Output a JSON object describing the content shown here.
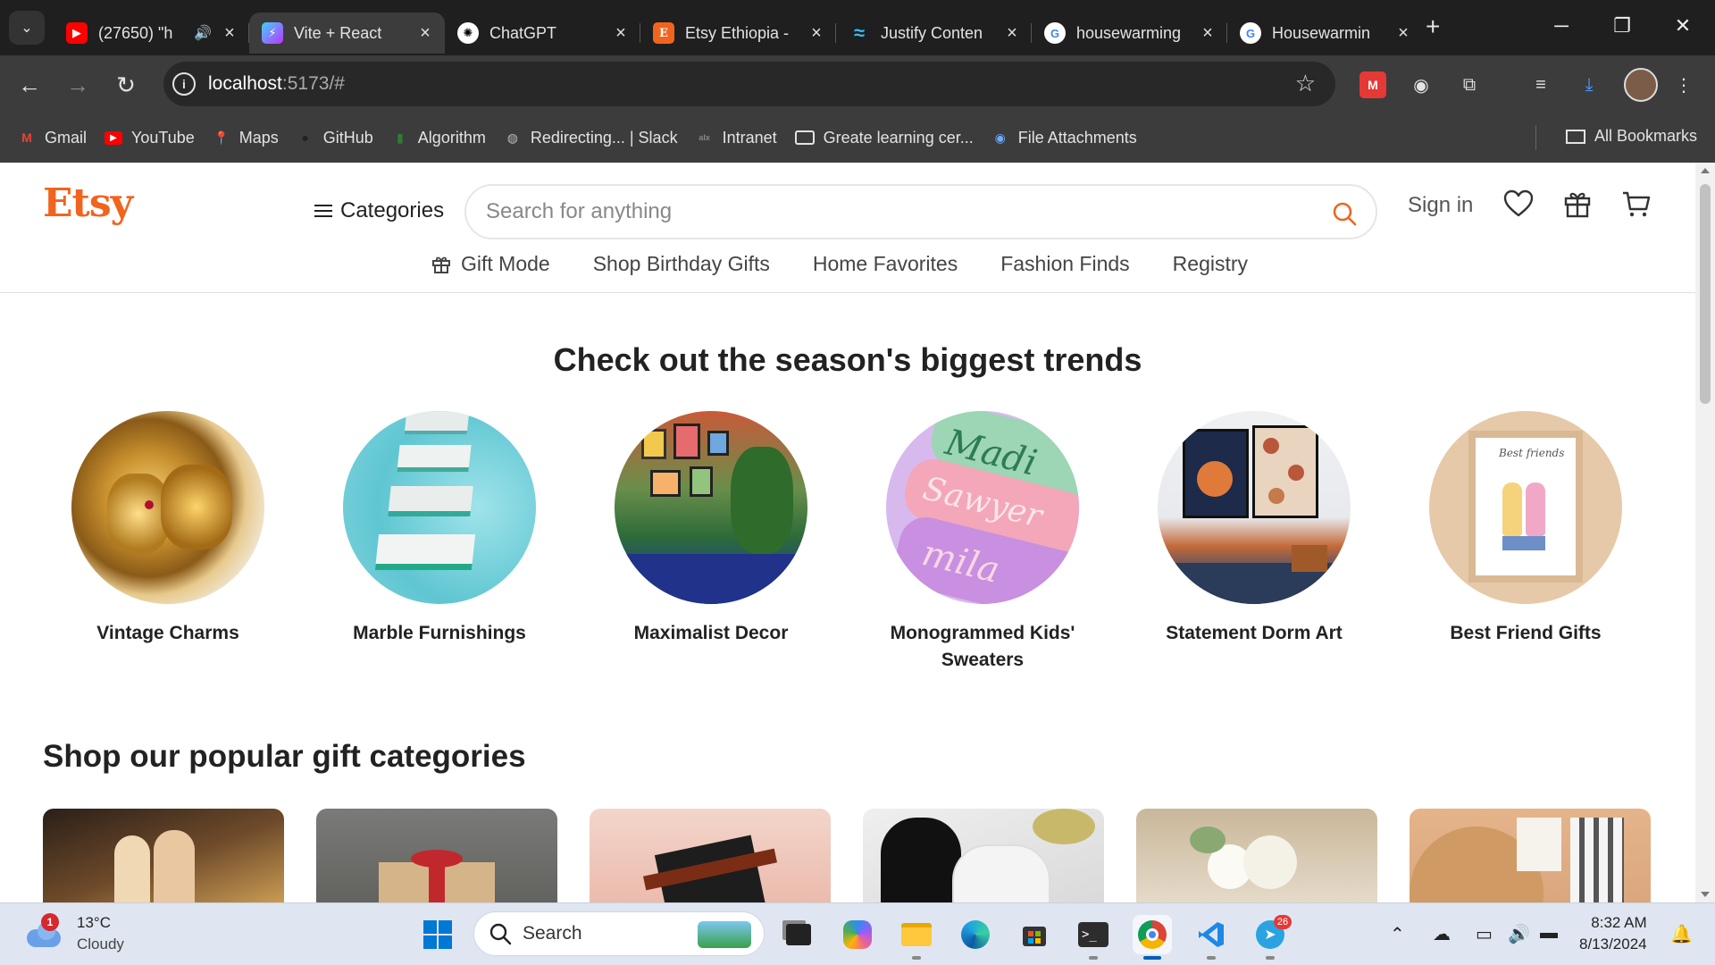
{
  "browser": {
    "tabs": [
      {
        "title": "(27650) \"h",
        "favicon": "youtube-icon",
        "color": "#ff0000",
        "glyph": "▶"
      },
      {
        "title": "Vite + React",
        "favicon": "vite-icon",
        "color": "#8b5cf6",
        "glyph": "⚡"
      },
      {
        "title": "ChatGPT",
        "favicon": "chatgpt-icon",
        "color": "#ffffff",
        "glyph": "✺"
      },
      {
        "title": "Etsy Ethiopia -",
        "favicon": "etsy-icon",
        "color": "#f1641e",
        "glyph": "E"
      },
      {
        "title": "Justify Conten",
        "favicon": "tailwind-icon",
        "color": "#38bdf8",
        "glyph": "≈"
      },
      {
        "title": "housewarming",
        "favicon": "google-icon",
        "color": "#ffffff",
        "glyph": "G"
      },
      {
        "title": "Housewarmin",
        "favicon": "google-icon",
        "color": "#ffffff",
        "glyph": "G"
      }
    ],
    "url_host": "localhost",
    "url_rest": ":5173/#",
    "bookmarks": [
      {
        "label": "Gmail",
        "icon": "gmail-icon",
        "color": "#ea4335",
        "glyph": "M"
      },
      {
        "label": "YouTube",
        "icon": "youtube-icon",
        "color": "#ff0000",
        "glyph": "▶"
      },
      {
        "label": "Maps",
        "icon": "maps-icon",
        "color": "#34a853",
        "glyph": "⬤"
      },
      {
        "label": "GitHub",
        "icon": "github-icon",
        "color": "#333333",
        "glyph": "●"
      },
      {
        "label": "Algorithm",
        "icon": "algorithm-icon",
        "color": "#2e7d32",
        "glyph": "▮"
      },
      {
        "label": "Redirecting... | Slack",
        "icon": "globe-icon",
        "color": "#9e9e9e",
        "glyph": "◍"
      },
      {
        "label": "Intranet",
        "icon": "intranet-icon",
        "color": "#555555",
        "glyph": "·"
      },
      {
        "label": "Greate learning cer...",
        "icon": "folder-icon",
        "color": "transparent",
        "glyph": "▭"
      },
      {
        "label": "File Attachments",
        "icon": "attachment-icon",
        "color": "#1a73e8",
        "glyph": "◉"
      }
    ],
    "all_bookmarks": "All Bookmarks"
  },
  "etsy": {
    "logo": "Etsy",
    "categories": "Categories",
    "search_placeholder": "Search for anything",
    "sign_in": "Sign in",
    "brand_color": "#F1641E",
    "nav": [
      "Gift Mode",
      "Shop Birthday Gifts",
      "Home Favorites",
      "Fashion Finds",
      "Registry"
    ],
    "trends_title": "Check out the season's biggest trends",
    "trends": [
      {
        "label": "Vintage Charms"
      },
      {
        "label": "Marble Furnishings"
      },
      {
        "label": "Maximalist Decor"
      },
      {
        "label": "Monogrammed Kids' Sweaters"
      },
      {
        "label": "Statement Dorm Art"
      },
      {
        "label": "Best Friend Gifts"
      }
    ],
    "gifts_title": "Shop our popular gift categories"
  },
  "taskbar": {
    "weather_temp": "13°C",
    "weather_desc": "Cloudy",
    "weather_badge": "1",
    "search": "Search",
    "telegram_badge": "26",
    "time": "8:32 AM",
    "date": "8/13/2024"
  }
}
